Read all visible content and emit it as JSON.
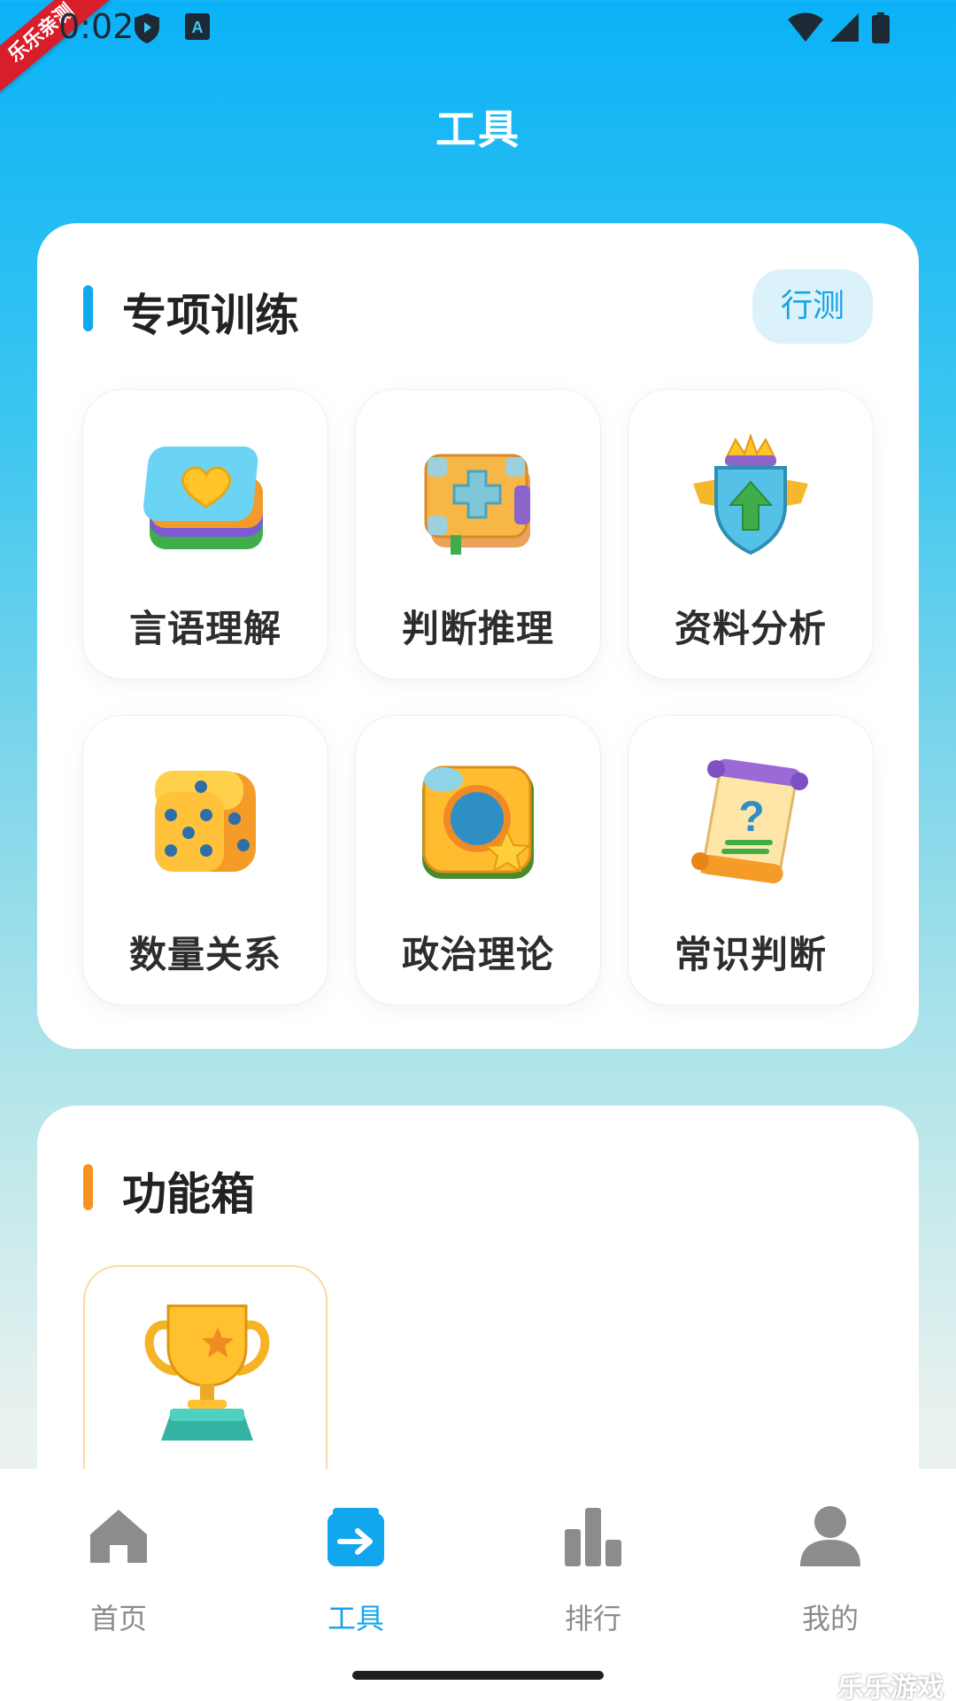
{
  "status_bar": {
    "time": "0:02",
    "ribbon_text": "乐乐亲测",
    "icons": [
      "shield-icon",
      "a-icon",
      "wifi-icon",
      "signal-icon",
      "battery-icon"
    ]
  },
  "header": {
    "title": "工具"
  },
  "training": {
    "title": "专项训练",
    "accent_color": "#1aa2e0",
    "filter_pill": "行测",
    "items": [
      {
        "label": "言语理解",
        "icon": "heart-cards-icon"
      },
      {
        "label": "判断推理",
        "icon": "medical-book-icon"
      },
      {
        "label": "资料分析",
        "icon": "crown-shield-icon"
      },
      {
        "label": "数量关系",
        "icon": "dice-icon"
      },
      {
        "label": "政治理论",
        "icon": "star-frame-icon"
      },
      {
        "label": "常识判断",
        "icon": "question-scroll-icon"
      }
    ]
  },
  "toolbox": {
    "title": "功能箱",
    "accent_color": "#f7931e",
    "items": [
      {
        "icon": "trophy-icon"
      }
    ]
  },
  "nav": {
    "active_color": "#12a6ee",
    "items": [
      {
        "label": "首页",
        "icon": "home-icon",
        "active": false
      },
      {
        "label": "工具",
        "icon": "tools-box-icon",
        "active": true
      },
      {
        "label": "排行",
        "icon": "bar-chart-icon",
        "active": false
      },
      {
        "label": "我的",
        "icon": "user-icon",
        "active": false
      }
    ]
  },
  "watermark": "乐乐游戏"
}
